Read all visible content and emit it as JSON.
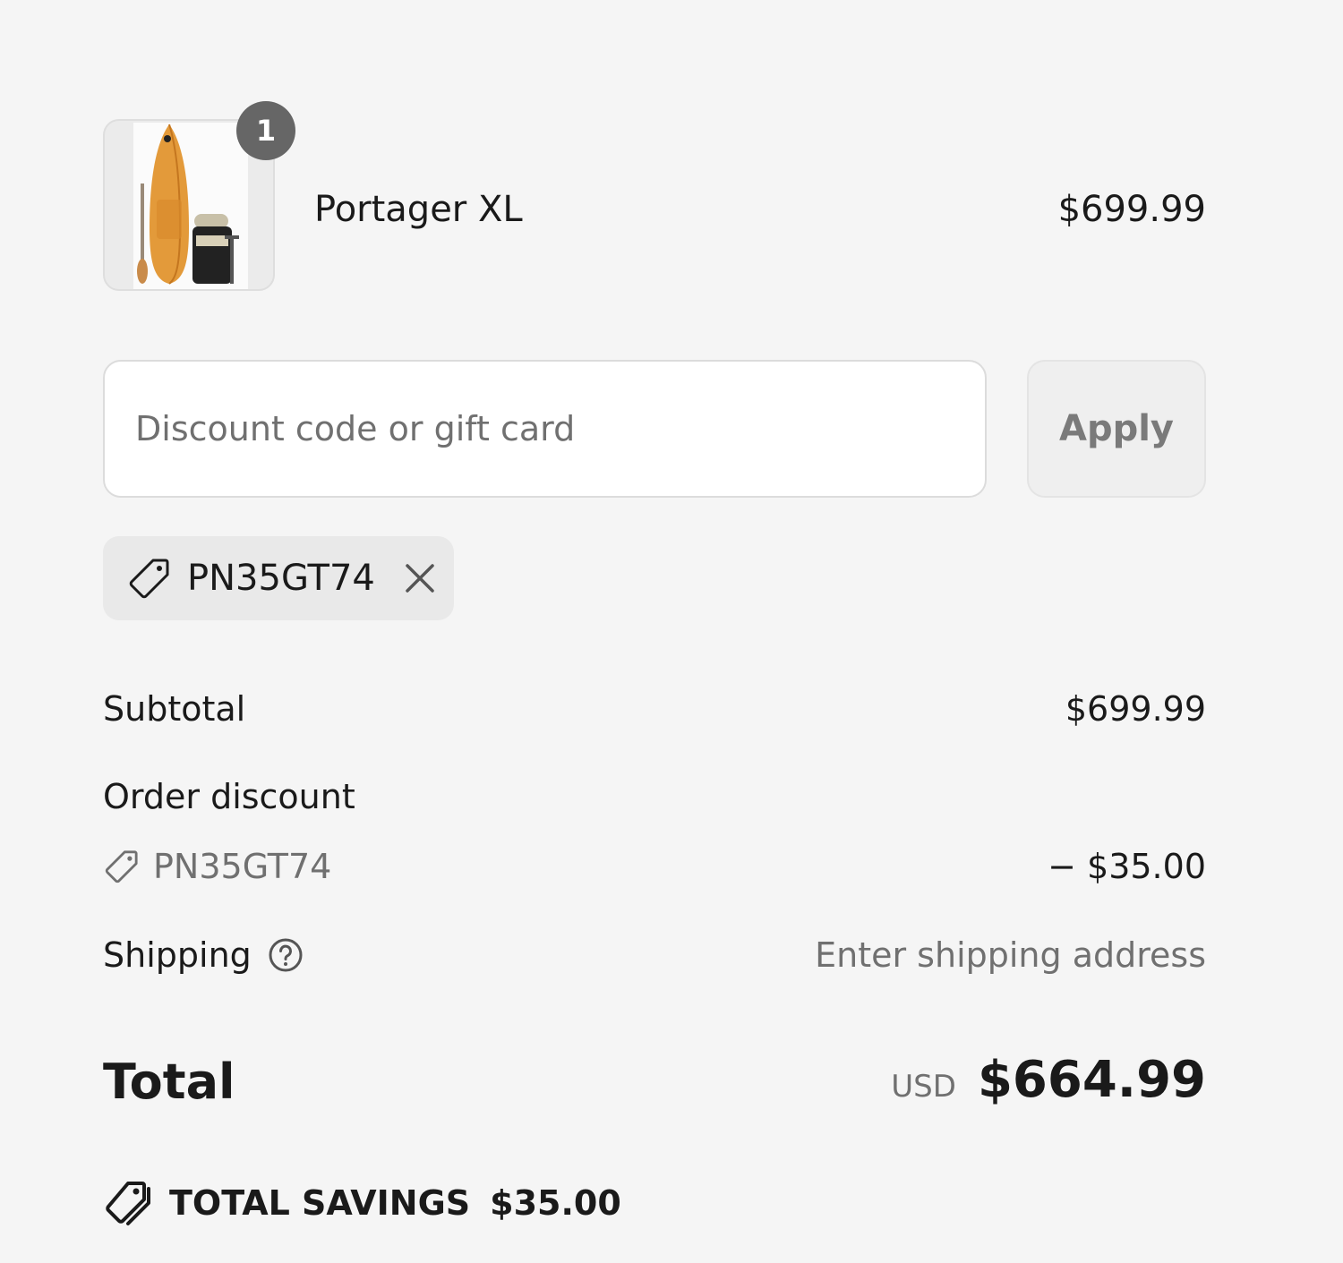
{
  "line_items": [
    {
      "name": "Portager XL",
      "price": "$699.99",
      "quantity": "1",
      "image_alt": "paddle-board-product-image"
    }
  ],
  "discount": {
    "placeholder": "Discount code or gift card",
    "value": "",
    "apply_label": "Apply",
    "applied_code": "PN35GT74"
  },
  "summary": {
    "subtotal_label": "Subtotal",
    "subtotal_value": "$699.99",
    "order_discount_label": "Order discount",
    "discount_code": "PN35GT74",
    "discount_amount": "− $35.00",
    "shipping_label": "Shipping",
    "shipping_value": "Enter shipping address",
    "total_label": "Total",
    "total_currency": "USD",
    "total_value": "$664.99",
    "savings_label": "TOTAL SAVINGS",
    "savings_value": "$35.00"
  },
  "icons": {
    "tag": "tag-icon",
    "remove": "close-icon",
    "help": "help-circle-icon",
    "savings": "savings-tags-icon"
  },
  "colors": {
    "background": "#f5f5f5",
    "text": "#1a1a1a",
    "muted_text": "#707070",
    "badge": "#666666",
    "chip": "#e9e9e9",
    "button": "#efefef",
    "input": "#ffffff"
  }
}
